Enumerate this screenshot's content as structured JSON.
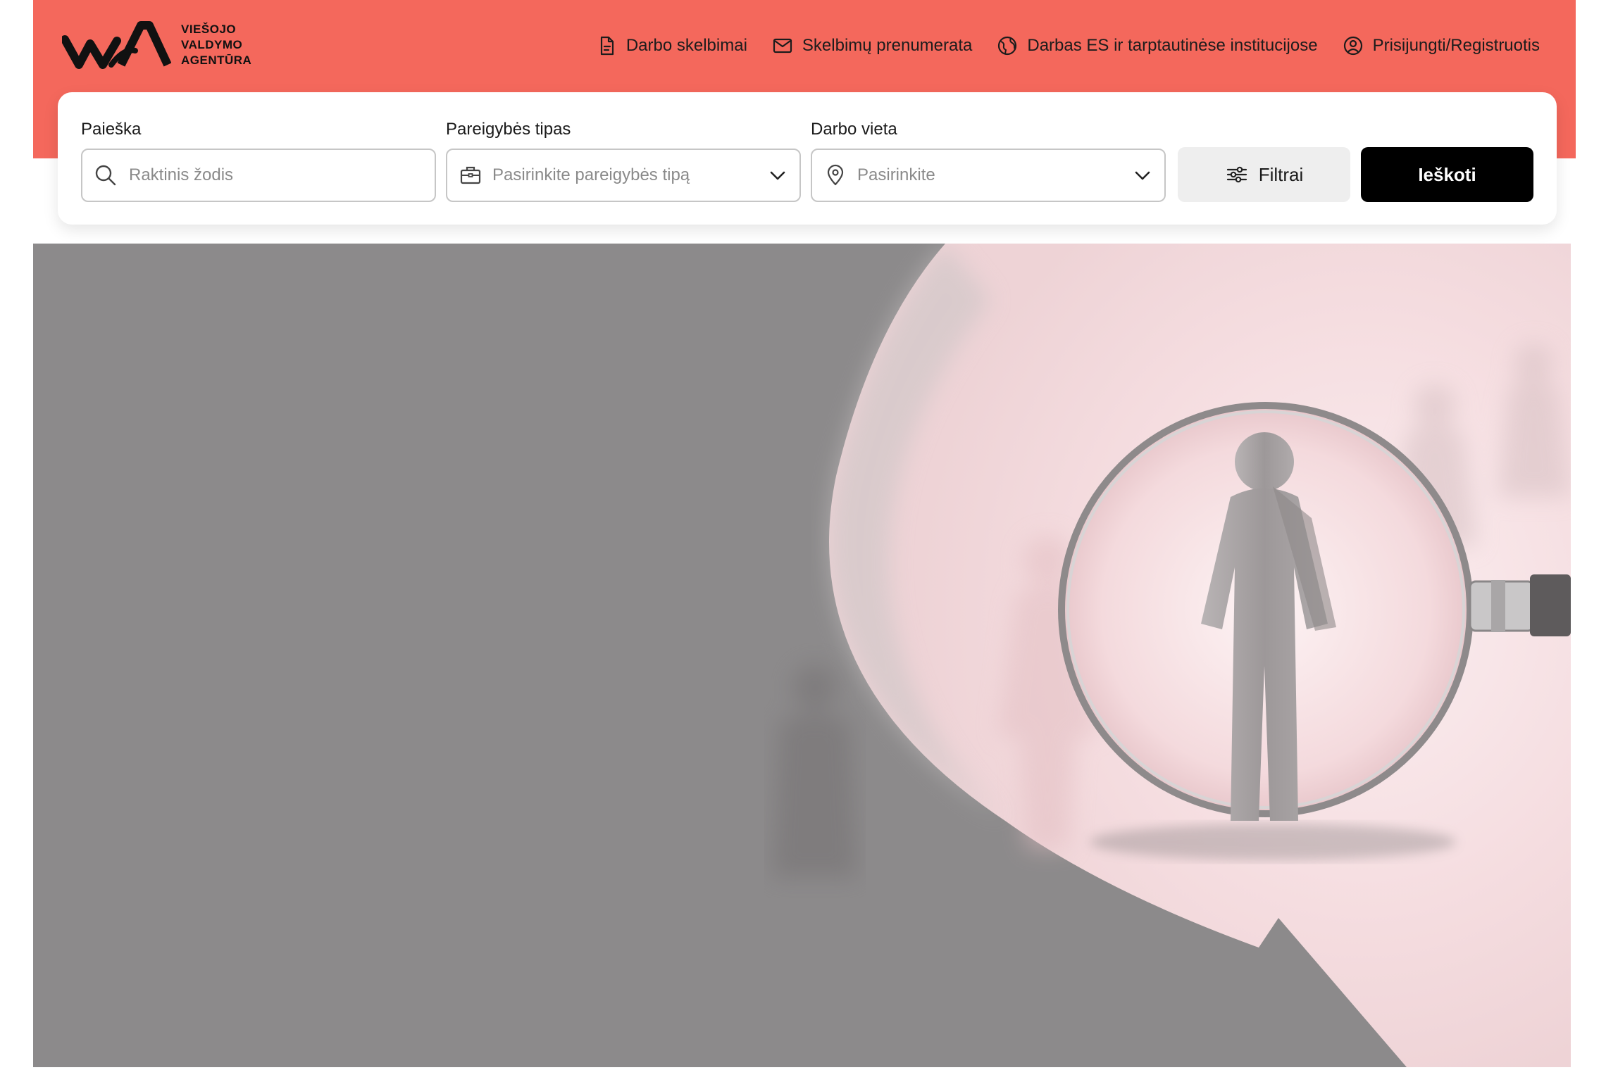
{
  "brand": {
    "logo_lines": [
      "VIEŠOJO",
      "VALDYMO",
      "AGENTŪRA"
    ],
    "accent_color": "#f4685c"
  },
  "nav": {
    "items": [
      {
        "label": "Darbo skelbimai",
        "icon": "document-icon"
      },
      {
        "label": "Skelbimų prenumerata",
        "icon": "envelope-icon"
      },
      {
        "label": "Darbas ES ir tarptautinėse institucijose",
        "icon": "globe-icon"
      },
      {
        "label": "Prisijungti/Registruotis",
        "icon": "user-circle-icon"
      }
    ]
  },
  "search": {
    "keyword": {
      "label": "Paieška",
      "placeholder": "Raktinis žodis",
      "value": ""
    },
    "position_type": {
      "label": "Pareigybės tipas",
      "placeholder": "Pasirinkite pareigybės tipą"
    },
    "location": {
      "label": "Darbo vieta",
      "placeholder": "Pasirinkite"
    },
    "filter_label": "Filtrai",
    "submit_label": "Ieškoti"
  },
  "hero": {
    "image": "magnifying-glass-over-figures"
  }
}
